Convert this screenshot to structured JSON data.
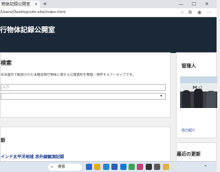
{
  "browser": {
    "tab_title": "物体記録公開室",
    "tab_close": "×",
    "new_tab": "+",
    "window_controls": {
      "minimize": "—",
      "maximize": "☐",
      "close": "✕"
    },
    "url": "/Users/Desktop/ufo-site/index.html",
    "icons": [
      "star-icon",
      "extensions-icon",
      "profile-icon",
      "menu-icon"
    ]
  },
  "site": {
    "title": "行物体記録公開室"
  },
  "search": {
    "heading": "検索",
    "description": "日本国内で観測された未確認飛行物体に関する公開資料を整理・保存するアーカイブです。",
    "input_placeholder": "入力",
    "select_value": ""
  },
  "updates": {
    "heading": "新",
    "items": [
      "インド太平洋地域 赤外線観測記録"
    ]
  },
  "sidebar": {
    "admin": {
      "heading": "管理人",
      "profile_link": "自己紹介"
    },
    "recent": {
      "heading": "最近の更新"
    }
  },
  "taskbar": {
    "search_label": "検索",
    "apps": [
      "windows-icon",
      "file-explorer-icon",
      "edge-icon",
      "store-icon",
      "mail-icon",
      "chrome-icon",
      "photos-icon",
      "terminal-icon",
      "settings-icon",
      "folder-icon"
    ],
    "app_colors": [
      "#1f6fd1",
      "#e2a92b",
      "#1b8ad6",
      "#2b5cb8",
      "#0f78d4",
      "#3fa34d",
      "#c2407a",
      "#333333",
      "#5a5a5a",
      "#e0b33a"
    ]
  }
}
